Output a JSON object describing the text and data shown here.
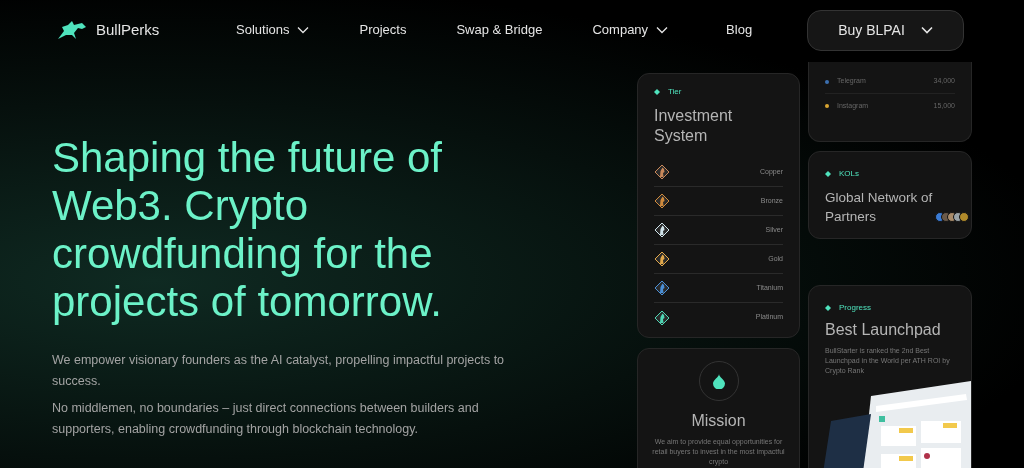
{
  "header": {
    "logo": "BullPerks",
    "nav": [
      {
        "label": "Solutions",
        "dropdown": true
      },
      {
        "label": "Projects",
        "dropdown": false
      },
      {
        "label": "Swap & Bridge",
        "dropdown": false
      },
      {
        "label": "Company",
        "dropdown": true
      },
      {
        "label": "Blog",
        "dropdown": false
      }
    ],
    "buy_button": "Buy BLPAI"
  },
  "hero": {
    "title": "Shaping the future of Web3. Crypto crowdfunding for the projects of tomorrow.",
    "paragraphs": [
      "We empower visionary founders as the AI catalyst, propelling impactful projects to success.",
      "No middlemen, no boundaries – just direct connections between builders and supporters, enabling crowdfunding through blockchain technology."
    ]
  },
  "tier_card": {
    "tag": "Tier",
    "title": "Investment System",
    "tiers": [
      {
        "name": "Copper",
        "color": "#c9885a"
      },
      {
        "name": "Bronze",
        "color": "#d08a3c"
      },
      {
        "name": "Silver",
        "color": "#cfe3ea"
      },
      {
        "name": "Gold",
        "color": "#e2a84a"
      },
      {
        "name": "Titanium",
        "color": "#4a8fd6"
      },
      {
        "name": "Platinum",
        "color": "#4fd6b4"
      }
    ]
  },
  "mission_card": {
    "title": "Mission",
    "text": "We aim to provide equal opportunities for retail buyers to invest in the most impactful crypto"
  },
  "social_card": {
    "rows": [
      {
        "name": "Telegram",
        "value": "34,000",
        "color": "#3b6fb0"
      },
      {
        "name": "Instagram",
        "value": "15,000",
        "color": "#d9a531"
      }
    ]
  },
  "kols_card": {
    "tag": "KOLs",
    "title": "Global Network of Partners"
  },
  "progress_card": {
    "tag": "Progress",
    "title": "Best Launchpad",
    "text": "BullStarter is ranked the 2nd Best Launchpad in the World per ATH ROI by Crypto Rank"
  }
}
